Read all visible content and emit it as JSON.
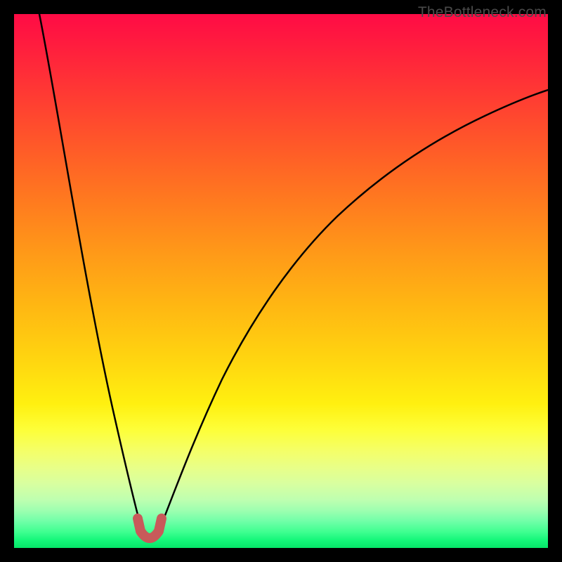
{
  "watermark": {
    "text": "TheBottleneck.com"
  },
  "chart_data": {
    "type": "line",
    "title": "",
    "xlabel": "",
    "ylabel": "",
    "xlim": [
      0,
      100
    ],
    "ylim": [
      0,
      100
    ],
    "grid": false,
    "series": [
      {
        "name": "bottleneck-curve",
        "x": [
          0,
          4,
          8,
          12,
          16,
          19,
          21,
          23,
          24,
          25,
          26,
          27,
          29,
          31,
          34,
          38,
          42,
          47,
          52,
          58,
          65,
          72,
          80,
          90,
          100
        ],
        "values": [
          100,
          84,
          68,
          52,
          36,
          21,
          12,
          5,
          2,
          1,
          2,
          5,
          12,
          21,
          33,
          44,
          53,
          61,
          67.5,
          73,
          77.8,
          81.5,
          84.5,
          87.5,
          89.5
        ]
      }
    ],
    "highlight": {
      "name": "minimum-marker",
      "x_range": [
        23,
        27
      ],
      "y": 2,
      "color": "#c85a5a"
    },
    "colors": {
      "curve": "#000000",
      "highlight": "#c85a5a",
      "frame_bg": "#000000",
      "gradient_top": "#ff0b45",
      "gradient_bottom": "#06e568"
    }
  }
}
